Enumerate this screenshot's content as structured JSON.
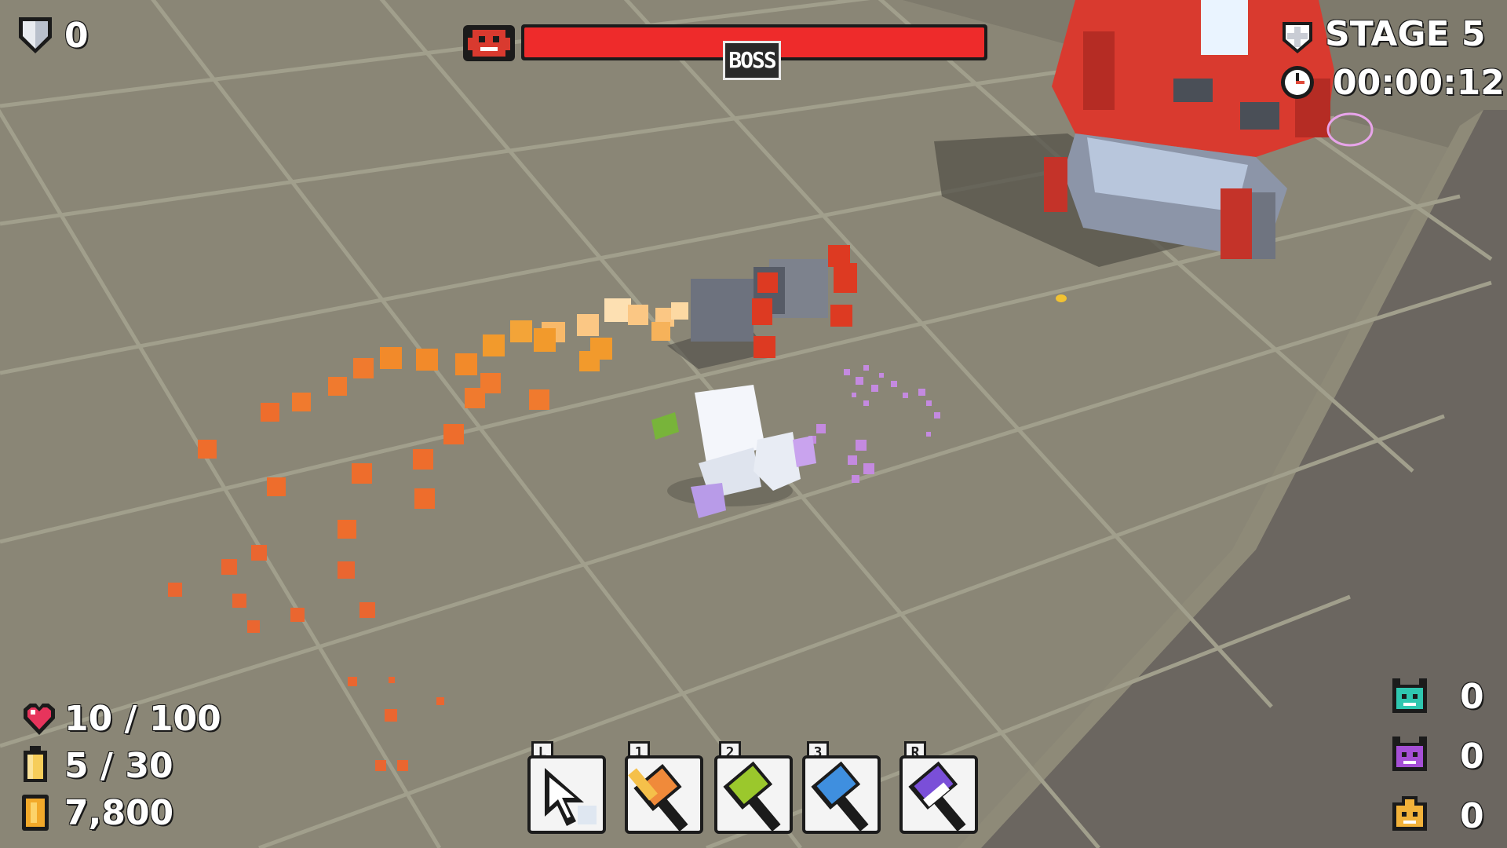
{
  "hud": {
    "shield": {
      "icon": "shield-icon",
      "value": "0"
    },
    "boss": {
      "icon": "boss-invader-icon",
      "label": "BOSS",
      "health_fraction": 1.0,
      "bar_color": "#ee2b2b"
    },
    "stage": {
      "icon": "shield-cross-icon",
      "label": "STAGE 5"
    },
    "timer": {
      "icon": "clock-icon",
      "value": "00:00:12"
    },
    "health": {
      "icon": "heart-icon",
      "value": "10 / 100"
    },
    "ammo": {
      "icon": "battery-icon",
      "value": "5 / 30"
    },
    "coins": {
      "icon": "coin-icon",
      "value": "7,800"
    },
    "enemy_counts": [
      {
        "icon": "teal-creature-icon",
        "color": "#2fc7b0",
        "value": "0"
      },
      {
        "icon": "purple-creature-icon",
        "color": "#a54fd6",
        "value": "0"
      },
      {
        "icon": "yellow-creature-icon",
        "color": "#f2b23a",
        "value": "0"
      }
    ]
  },
  "hotbar": [
    {
      "key": "L",
      "icon": "cursor-icon"
    },
    {
      "key": "1",
      "icon": "orange-hammer-icon",
      "color": "#f08a3a"
    },
    {
      "key": "2",
      "icon": "green-hammer-icon",
      "color": "#9bc82c"
    },
    {
      "key": "3",
      "icon": "blue-hammer-icon",
      "color": "#3f8fdf"
    },
    {
      "key": "R",
      "icon": "purple-hammer-icon",
      "color": "#7a4fd8"
    }
  ],
  "colors": {
    "floor": "#8a8676",
    "grout": "#a4a290",
    "wall": "#6b6660",
    "boss": "#d93a2f",
    "particles": "#f07a2e"
  }
}
